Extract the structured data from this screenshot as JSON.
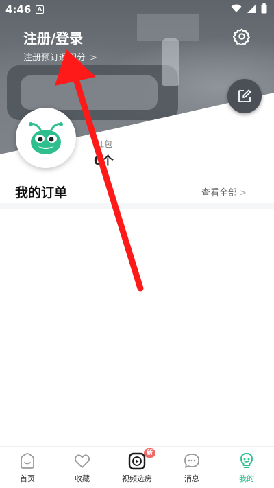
{
  "status_bar": {
    "time": "4:46",
    "notif_letter": "A"
  },
  "header": {
    "title": "注册/登录",
    "subtitle": "注册预订返积分",
    "subtitle_chevron": ">"
  },
  "stats": {
    "redpack_label": "红包",
    "redpack_count": "0个"
  },
  "orders": {
    "title": "我的订单",
    "view_all": "查看全部",
    "chevron": ">"
  },
  "tabs": [
    {
      "label": "首页",
      "icon": "home-icon",
      "active": false
    },
    {
      "label": "收藏",
      "icon": "heart-icon",
      "active": false
    },
    {
      "label": "视频选房",
      "icon": "video-play-icon",
      "badge": "新",
      "active": false
    },
    {
      "label": "消息",
      "icon": "chat-bubble-icon",
      "active": false
    },
    {
      "label": "我的",
      "icon": "profile-lightbulb-icon",
      "active": true
    }
  ],
  "colors": {
    "accent": "#2fbf8f",
    "annotation_arrow": "#ff1a1a",
    "badge": "#f06a6a",
    "mascot": "#2fbf8f"
  }
}
